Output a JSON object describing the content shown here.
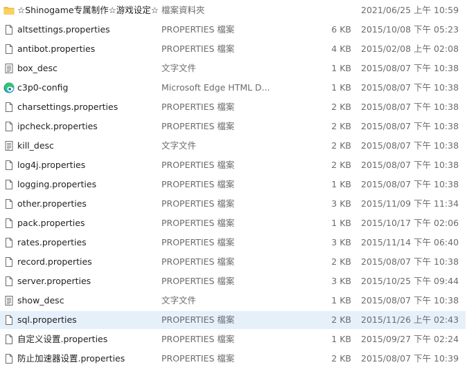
{
  "file_list": {
    "rows": [
      {
        "name": "☆Shinogame专属制作☆游戏设定☆",
        "type": "檔案資料夾",
        "size": "",
        "modified": "2021/06/25 上午 10:59",
        "icon": "folder-icon",
        "selected": false
      },
      {
        "name": "altsettings.properties",
        "type": "PROPERTIES 檔案",
        "size": "6 KB",
        "modified": "2015/10/08 下午 05:23",
        "icon": "file-icon",
        "selected": false
      },
      {
        "name": "antibot.properties",
        "type": "PROPERTIES 檔案",
        "size": "4 KB",
        "modified": "2015/02/08 上午 02:08",
        "icon": "file-icon",
        "selected": false
      },
      {
        "name": "box_desc",
        "type": "文字文件",
        "size": "1 KB",
        "modified": "2015/08/07 下午 10:38",
        "icon": "text-file-icon",
        "selected": false
      },
      {
        "name": "c3p0-config",
        "type": "Microsoft Edge HTML D...",
        "size": "1 KB",
        "modified": "2015/08/07 下午 10:38",
        "icon": "edge-icon",
        "selected": false
      },
      {
        "name": "charsettings.properties",
        "type": "PROPERTIES 檔案",
        "size": "2 KB",
        "modified": "2015/08/07 下午 10:38",
        "icon": "file-icon",
        "selected": false
      },
      {
        "name": "ipcheck.properties",
        "type": "PROPERTIES 檔案",
        "size": "2 KB",
        "modified": "2015/08/07 下午 10:38",
        "icon": "file-icon",
        "selected": false
      },
      {
        "name": "kill_desc",
        "type": "文字文件",
        "size": "2 KB",
        "modified": "2015/08/07 下午 10:38",
        "icon": "text-file-icon",
        "selected": false
      },
      {
        "name": "log4j.properties",
        "type": "PROPERTIES 檔案",
        "size": "2 KB",
        "modified": "2015/08/07 下午 10:38",
        "icon": "file-icon",
        "selected": false
      },
      {
        "name": "logging.properties",
        "type": "PROPERTIES 檔案",
        "size": "1 KB",
        "modified": "2015/08/07 下午 10:38",
        "icon": "file-icon",
        "selected": false
      },
      {
        "name": "other.properties",
        "type": "PROPERTIES 檔案",
        "size": "3 KB",
        "modified": "2015/11/09 下午 11:34",
        "icon": "file-icon",
        "selected": false
      },
      {
        "name": "pack.properties",
        "type": "PROPERTIES 檔案",
        "size": "1 KB",
        "modified": "2015/10/17 下午 02:06",
        "icon": "file-icon",
        "selected": false
      },
      {
        "name": "rates.properties",
        "type": "PROPERTIES 檔案",
        "size": "3 KB",
        "modified": "2015/11/14 下午 06:40",
        "icon": "file-icon",
        "selected": false
      },
      {
        "name": "record.properties",
        "type": "PROPERTIES 檔案",
        "size": "2 KB",
        "modified": "2015/08/07 下午 10:38",
        "icon": "file-icon",
        "selected": false
      },
      {
        "name": "server.properties",
        "type": "PROPERTIES 檔案",
        "size": "3 KB",
        "modified": "2015/10/25 下午 09:44",
        "icon": "file-icon",
        "selected": false
      },
      {
        "name": "show_desc",
        "type": "文字文件",
        "size": "1 KB",
        "modified": "2015/08/07 下午 10:38",
        "icon": "text-file-icon",
        "selected": false
      },
      {
        "name": "sql.properties",
        "type": "PROPERTIES 檔案",
        "size": "2 KB",
        "modified": "2015/11/26 上午 02:43",
        "icon": "file-icon",
        "selected": true
      },
      {
        "name": "自定义设置.properties",
        "type": "PROPERTIES 檔案",
        "size": "1 KB",
        "modified": "2015/09/27 下午 02:24",
        "icon": "file-icon",
        "selected": false
      },
      {
        "name": "防止加速器设置.properties",
        "type": "PROPERTIES 檔案",
        "size": "2 KB",
        "modified": "2015/08/07 下午 10:39",
        "icon": "file-icon",
        "selected": false
      }
    ]
  },
  "colors": {
    "selection_bg": "#e5f0fb",
    "folder_yellow": "#f8c542",
    "edge_blue": "#0c72d1",
    "edge_green": "#35c46b",
    "secondary_text": "#6b6b6b"
  }
}
